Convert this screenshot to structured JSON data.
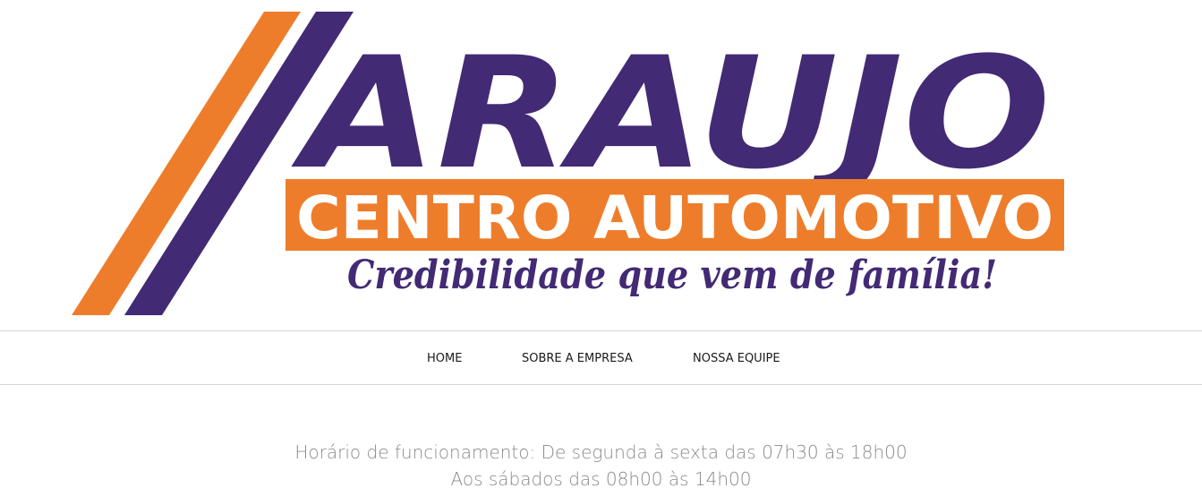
{
  "logo": {
    "brand_name": "ARAUJO",
    "banner_text": "CENTRO AUTOMOTIVO",
    "slogan": "Credibilidade que vem de família!",
    "colors": {
      "orange": "#ee7d2b",
      "purple": "#432a74",
      "banner_text": "#ffffff"
    }
  },
  "nav": {
    "items": [
      {
        "label": "HOME"
      },
      {
        "label": "SOBRE A EMPRESA"
      },
      {
        "label": "NOSSA EQUIPE"
      }
    ]
  },
  "hours": {
    "line1": "Horário de funcionamento: De segunda à sexta das 07h30 às 18h00",
    "line2": "Aos sábados das 08h00 às 14h00"
  }
}
